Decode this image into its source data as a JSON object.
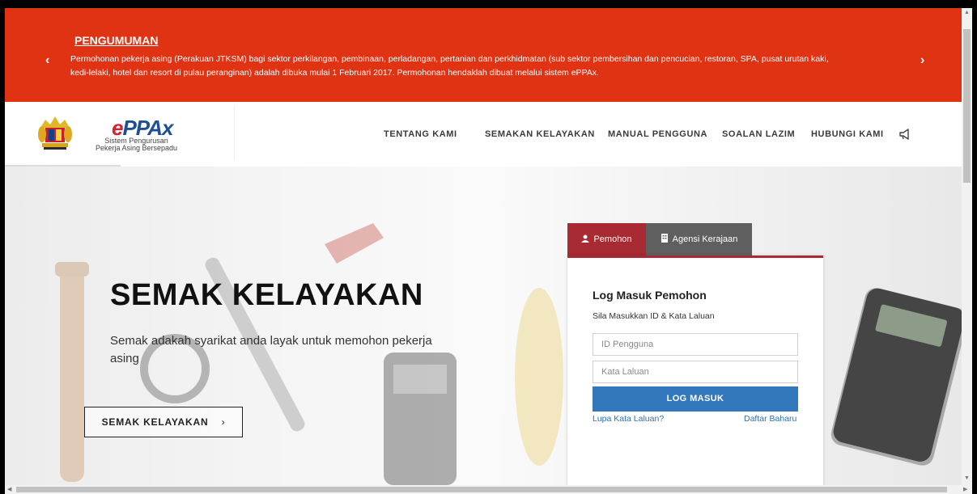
{
  "announcement": {
    "title": "PENGUMUMAN",
    "message": "Permohonan pekerja asing (Perakuan JTKSM) bagi sektor perkilangan, pembinaan, perladangan, pertanian dan perkhidmatan (sub sektor pembersihan dan pencucian, restoran, SPA, pusat urutan kaki, kedi-lelaki, hotel dan resort di pulau peranginan) adalah dibuka mulai 1 Februari 2017. Permohonan hendaklah dibuat melalui sistem ePPAx.",
    "prev_glyph": "‹",
    "next_glyph": "›",
    "color": "#e03314"
  },
  "logo": {
    "brand": "ePPAx",
    "subtitle_line1": "Sistem Pengurusan",
    "subtitle_line2": "Pekerja Asing Bersepadu"
  },
  "nav": {
    "items": [
      "TENTANG KAMI",
      "SEMAKAN KELAYAKAN",
      "MANUAL PENGGUNA",
      "SOALAN LAZIM",
      "HUBUNGI KAMI"
    ],
    "icon": "megaphone-icon"
  },
  "hero": {
    "title": "SEMAK KELAYAKAN",
    "description": "Semak adakah syarikat anda layak untuk memohon pekerja asing",
    "button_label": "SEMAK KELAYAKAN",
    "button_glyph": "›"
  },
  "login": {
    "tabs": [
      {
        "label": "Pemohon",
        "icon": "user-icon",
        "active": true
      },
      {
        "label": "Agensi Kerajaan",
        "icon": "building-icon",
        "active": false
      }
    ],
    "heading": "Log Masuk Pemohon",
    "hint": "Sila Masukkan ID & Kata Laluan",
    "username_placeholder": "ID Pengguna",
    "password_placeholder": "Kata Laluan",
    "submit_label": "LOG MASUK",
    "forgot_link": "Lupa Kata Laluan?",
    "register_link": "Daftar Baharu",
    "accent_color": "#a82a32",
    "button_color": "#3378bd"
  }
}
